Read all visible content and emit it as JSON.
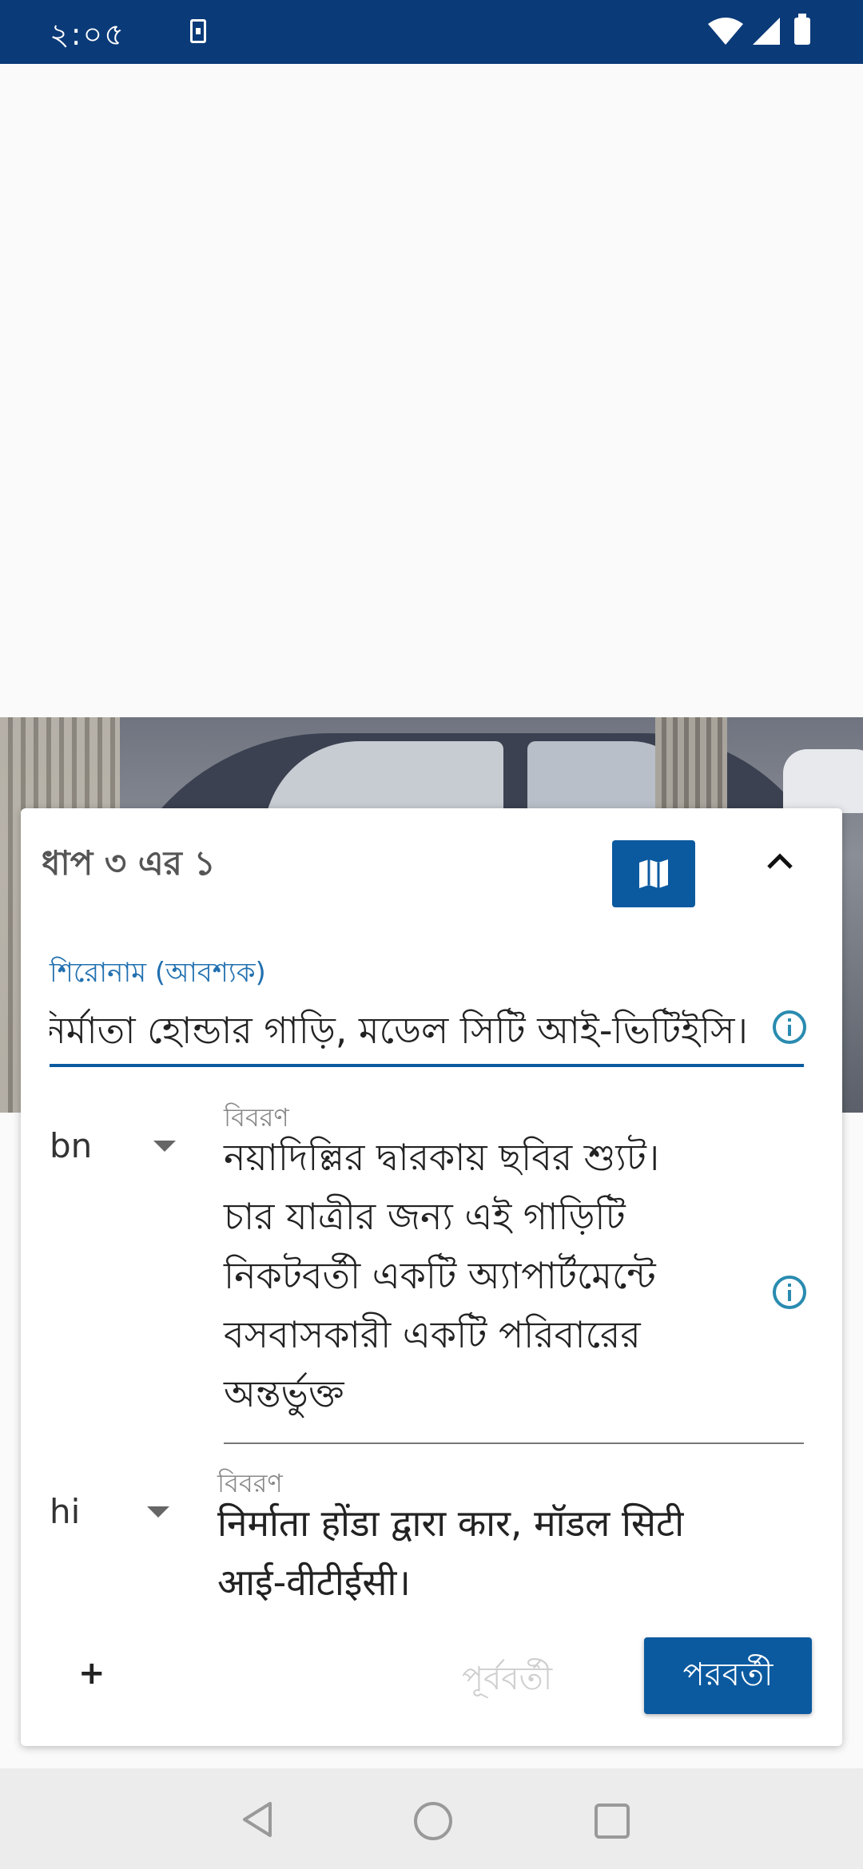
{
  "status_bar": {
    "time": "২:০৫",
    "icons": [
      "sim-card-icon",
      "wifi-icon",
      "signal-icon",
      "battery-icon"
    ]
  },
  "header": {
    "step_text": "ধাপ ৩ এর ১",
    "map_button_icon": "map-icon",
    "collapse_icon": "chevron-up-icon"
  },
  "caption": {
    "label": "শিরোনাম (আবশ্যক)",
    "value": "নির্মাতা হোন্ডার গাড়ি, মডেল সিটি আই-ভিটিইসি।"
  },
  "descriptions": [
    {
      "language": "bn",
      "label": "বিবরণ",
      "lines": [
        "নয়াদিল্লির দ্বারকায় ছবির শ্যুট।",
        "চার যাত্রীর জন্য এই গাড়িটি",
        "নিকটবর্তী একটি অ্যাপার্টমেন্টে",
        "বসবাসকারী একটি পরিবারের",
        "অন্তর্ভুক্ত"
      ]
    },
    {
      "language": "hi",
      "label": "বিবরণ",
      "lines": [
        "निर्माता होंडा द्वारा कार, मॉडल सिटी",
        "आई-वीटीईसी।"
      ]
    }
  ],
  "footer": {
    "add_label": "+",
    "previous_label": "পূর্ববর্তী",
    "next_label": "পরবর্তী"
  },
  "colors": {
    "accent": "#0b5aa0",
    "status_bar": "#0a3a78",
    "disabled_text": "#cfcfcf"
  }
}
